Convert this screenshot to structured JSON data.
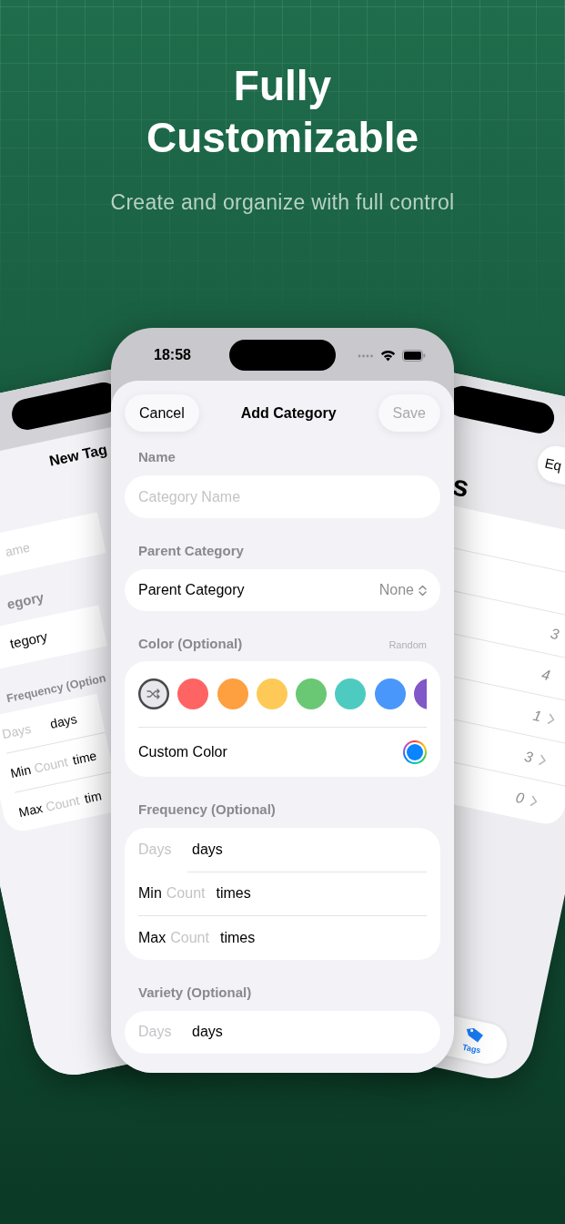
{
  "headline": {
    "title": "Fully Customizable",
    "subtitle": "Create and organize with full control"
  },
  "left_phone": {
    "title": "New Tag",
    "name_placeholder": "ame",
    "section_header": "egory",
    "picker_label": "tegory",
    "frequency_header": "Frequency (Option",
    "frequency_rows": [
      {
        "placeholder": "Days",
        "unit": "days"
      },
      {
        "label": "Min",
        "placeholder": "Count",
        "unit": "time"
      },
      {
        "label": "Max",
        "placeholder": "Count",
        "unit": "tim"
      }
    ]
  },
  "right_phone": {
    "button": "Eq",
    "title": "s",
    "counts": [
      {
        "value": "3",
        "chevron": false
      },
      {
        "value": "4",
        "chevron": false
      },
      {
        "value": "1",
        "chevron": true
      },
      {
        "value": "3",
        "chevron": true
      },
      {
        "value": "0",
        "chevron": true
      }
    ],
    "tab": {
      "label": "Tags",
      "selected": true
    }
  },
  "status_bar": {
    "time": "18:58"
  },
  "nav": {
    "cancel": "Cancel",
    "title": "Add Category",
    "save": "Save",
    "save_disabled": true
  },
  "sections": [
    {
      "kind": "text_field",
      "header": "Name",
      "placeholder": "Category Name"
    },
    {
      "kind": "picker",
      "header": "Parent Category",
      "label": "Parent Category",
      "value": "None"
    },
    {
      "kind": "color",
      "header": "Color (Optional)",
      "accessory": "Random",
      "custom_label": "Custom Color",
      "swatches": [
        {
          "kind": "random",
          "selected": true
        },
        {
          "kind": "color",
          "color": "#fe6463",
          "selected": false
        },
        {
          "kind": "color",
          "color": "#fe9f40",
          "selected": false
        },
        {
          "kind": "color",
          "color": "#fec957",
          "selected": false
        },
        {
          "kind": "color",
          "color": "#6ac874",
          "selected": false
        },
        {
          "kind": "color",
          "color": "#4ecbc0",
          "selected": false
        },
        {
          "kind": "color",
          "color": "#4a97fb",
          "selected": false
        },
        {
          "kind": "color",
          "color": "#8058c8",
          "selected": false
        }
      ]
    },
    {
      "kind": "range",
      "header": "Frequency (Optional)",
      "rows": [
        {
          "placeholder": "Days",
          "unit": "days"
        },
        {
          "label": "Min",
          "placeholder": "Count",
          "unit": "times"
        },
        {
          "label": "Max",
          "placeholder": "Count",
          "unit": "times"
        }
      ]
    },
    {
      "kind": "range",
      "header": "Variety (Optional)",
      "rows": [
        {
          "placeholder": "Days",
          "unit": "days"
        }
      ]
    }
  ]
}
